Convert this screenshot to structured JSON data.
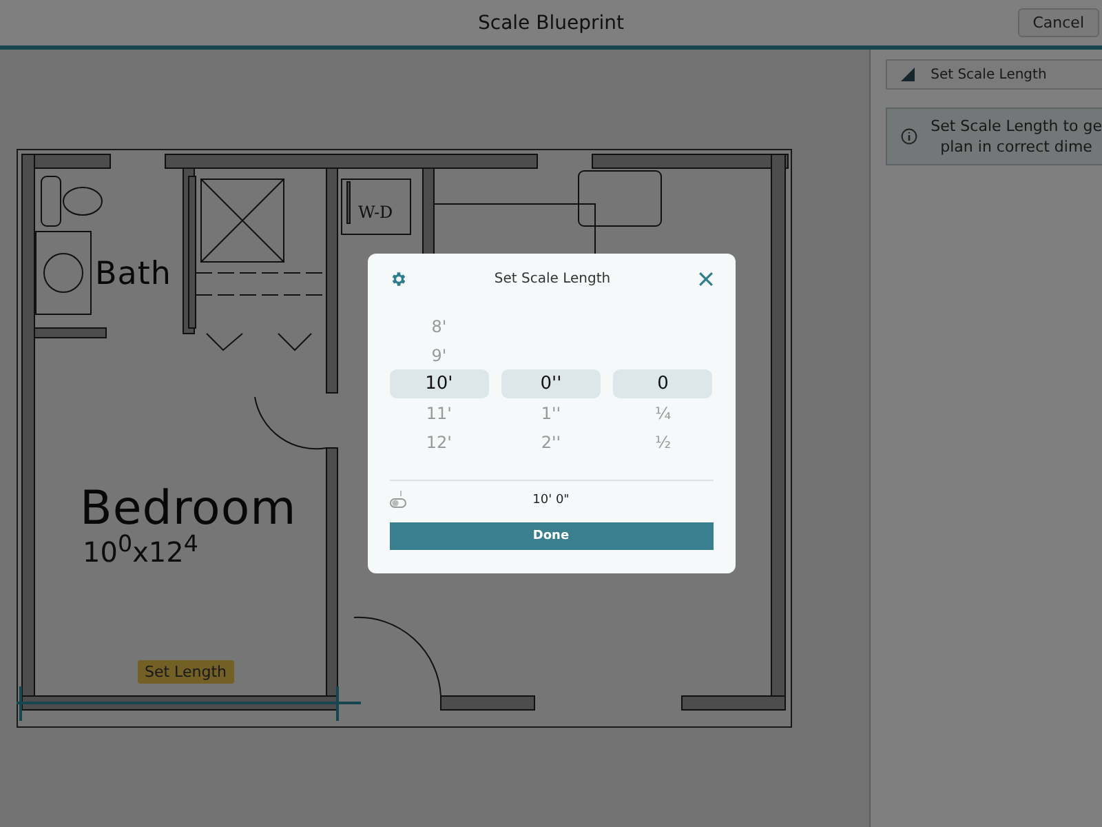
{
  "header": {
    "title": "Scale Blueprint",
    "cancel": "Cancel"
  },
  "blueprint": {
    "labels": [
      {
        "kind": "room",
        "text": "Bath"
      },
      {
        "kind": "room",
        "text": "Bedroom"
      },
      {
        "kind": "dimension",
        "text": "10$^{0}$x12$^{4}$"
      },
      {
        "kind": "appliance",
        "text": "W-D"
      }
    ],
    "measure_tag": "Set Length"
  },
  "side_panel": {
    "button": "Set Scale Length",
    "info": [
      "Set Scale Length to ge",
      "plan in correct dime"
    ]
  },
  "dialog": {
    "title": "Set Scale Length",
    "columns": [
      {
        "items": [
          {
            "label": "8'",
            "selected": false
          },
          {
            "label": "9'",
            "selected": false
          },
          {
            "label": "10'",
            "selected": true
          },
          {
            "label": "11'",
            "selected": false
          },
          {
            "label": "12'",
            "selected": false
          }
        ]
      },
      {
        "items": [
          {
            "label": "0''",
            "selected": true
          },
          {
            "label": "1''",
            "selected": false
          },
          {
            "label": "2''",
            "selected": false
          }
        ]
      },
      {
        "items": [
          {
            "label": "0",
            "selected": true
          },
          {
            "label": "¼",
            "selected": false
          },
          {
            "label": "½",
            "selected": false
          }
        ]
      }
    ],
    "reading": "10' 0\"",
    "done": "Done"
  }
}
